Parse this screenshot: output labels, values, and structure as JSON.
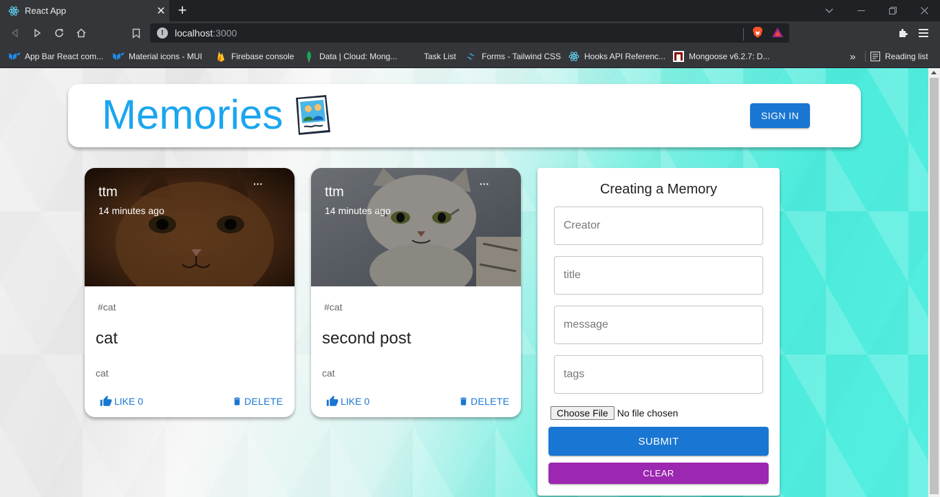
{
  "browser": {
    "tab_title": "React App",
    "url_host": "localhost",
    "url_port": ":3000",
    "reading_list": "Reading list",
    "bookmarks": [
      {
        "label": "App Bar React com...",
        "icon": "mui-icon"
      },
      {
        "label": "Material icons - MUI",
        "icon": "mui-icon"
      },
      {
        "label": "Firebase console",
        "icon": "firebase-icon"
      },
      {
        "label": "Data | Cloud: Mong...",
        "icon": "mongodb-leaf-icon"
      },
      {
        "label": "Task List",
        "icon": "blank-icon"
      },
      {
        "label": "Forms - Tailwind CSS",
        "icon": "tailwind-icon"
      },
      {
        "label": "Hooks API Referenc...",
        "icon": "react-icon"
      },
      {
        "label": "Mongoose v6.2.7: D...",
        "icon": "mongoose-icon"
      }
    ],
    "overflow_label": "»"
  },
  "app": {
    "title": "Memories",
    "signin_label": "SIGN IN"
  },
  "posts": [
    {
      "author": "ttm",
      "time": "14 minutes ago",
      "tags": "#cat",
      "title": "cat",
      "message": "cat",
      "like_label": "LIKE 0",
      "delete_label": "DELETE",
      "more_label": "···"
    },
    {
      "author": "ttm",
      "time": "14 minutes ago",
      "tags": "#cat",
      "title": "second post",
      "message": "cat",
      "like_label": "LIKE 0",
      "delete_label": "DELETE",
      "more_label": "···"
    }
  ],
  "form": {
    "title": "Creating a Memory",
    "creator_placeholder": "Creator",
    "title_placeholder": "title",
    "message_placeholder": "message",
    "tags_placeholder": "tags",
    "file_button": "Choose File",
    "file_status": "No file chosen",
    "submit_label": "SUBMIT",
    "clear_label": "CLEAR"
  },
  "colors": {
    "primary": "#1976d2",
    "secondary": "#9c27b0",
    "title_blue": "#1ba6ee"
  }
}
